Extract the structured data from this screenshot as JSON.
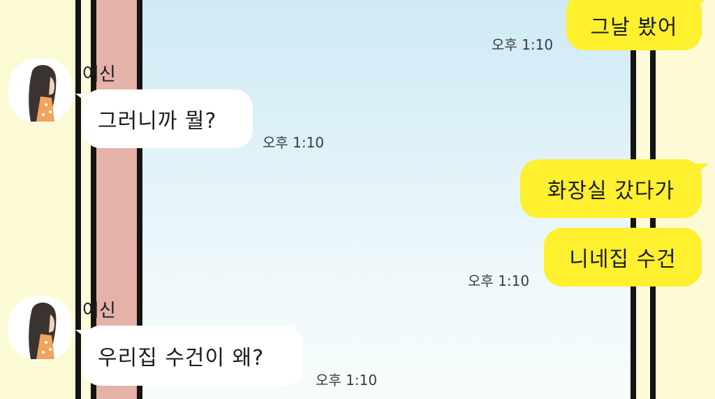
{
  "chat": {
    "messages": [
      {
        "direction": "out",
        "text": "그날 봤어",
        "time": "오후 1:10"
      },
      {
        "direction": "in",
        "sender": "여신",
        "text": "그러니까 뭘?",
        "time": "오후 1:10"
      },
      {
        "direction": "out",
        "text": "화장실 갔다가"
      },
      {
        "direction": "out",
        "text": "니네집 수건",
        "time": "오후 1:10"
      },
      {
        "direction": "in",
        "sender": "여신",
        "text": "우리집 수건이 왜?",
        "time": "오후 1:10"
      }
    ]
  },
  "colors": {
    "outgoing_bubble": "#fef02f",
    "incoming_bubble": "#ffffff",
    "curtain": "#e5b2a8",
    "sky": "#d9eff7"
  },
  "icons": {
    "avatar": "girl-avatar-icon"
  }
}
